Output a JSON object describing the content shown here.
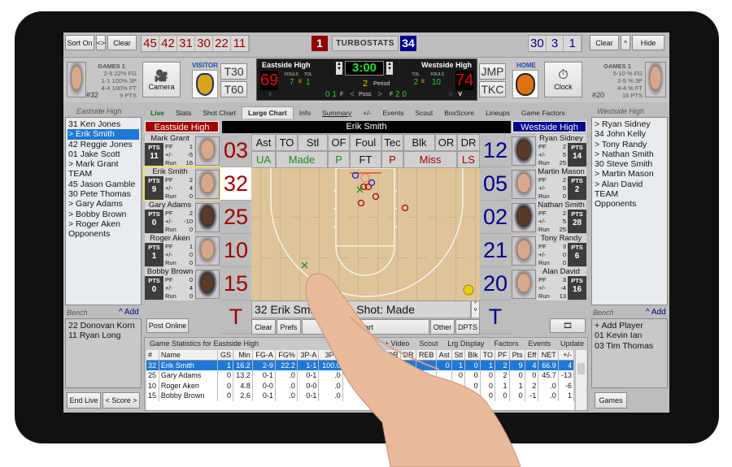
{
  "topbar": {
    "sort_label": "Sort On",
    "swap_label": "<>",
    "clear_left": "Clear",
    "left_numbers": [
      "45",
      "42",
      "31",
      "30",
      "22",
      "11"
    ],
    "left_team_count": "1",
    "logo": "TURBOSTATS",
    "right_team_count": "34",
    "right_numbers": [
      "30",
      "3",
      "1"
    ],
    "clear_right": "Clear",
    "up_label": "^",
    "hide_label": "Hide"
  },
  "visitor_player": {
    "games": "GAMES 1",
    "fg": "2-9 22% FG",
    "p3": "1-1 100% 3P",
    "ft": "4-4 100% FT",
    "number": "#32",
    "pts": "9 PTS"
  },
  "home_player": {
    "games": "GAMES 1",
    "fg": "5-10 % FG",
    "p3": "2-5 % 3P",
    "ft": "4-4 % FT",
    "number": "#20",
    "pts": "16 PTS"
  },
  "controls": {
    "camera": "Camera",
    "visitor": "VISITOR",
    "t30": "T30",
    "t60": "T60",
    "jmp": "JMP",
    "tkc": "TKC",
    "home": "HOME",
    "clock": "Clock"
  },
  "scoreboard": {
    "visitor_name": "Eastside High",
    "home_name": "Westside High",
    "visitor_score": "69",
    "home_score": "74",
    "clock": "3:00",
    "period": "2",
    "period_label": "Period",
    "fouls_label": "FOULS",
    "tol_label": "TOL",
    "visitor_fouls": "7",
    "visitor_tol": "1",
    "home_fouls": "10",
    "home_tol": "2",
    "bonus": "B",
    "visitor_sub": "9",
    "home_sub": "0",
    "home_sub2": "V",
    "poss_left": "0 1",
    "poss_right": "2 0",
    "f": "F",
    "poss": "Poss",
    "lt": "<",
    "gt": ">"
  },
  "tabs": [
    "Live",
    "Stats",
    "Shot Chart",
    "Large Chart",
    "Info",
    "Summary",
    "+/-",
    "Events",
    "Scout",
    "BoxScore",
    "Lineups",
    "Game Factors"
  ],
  "active_tab": "Large Chart",
  "left_list": {
    "title": "Eastside High",
    "items": [
      "31 Ken Jones",
      "> Erik Smith",
      "42 Reggie Jones",
      "01 Jake Scott",
      "> Mark Grant",
      "TEAM",
      "45 Jason Gamble",
      "30 Pete Thomas",
      "> Gary Adams",
      "> Bobby Brown",
      "> Roger Aken",
      "Opponents"
    ],
    "selected": "> Erik Smith",
    "bench_label": "Bench",
    "add_label": "^ Add",
    "bench": [
      "22 Donovan Korn",
      "11 Ryan Long"
    ],
    "end_live": "End Live",
    "score": "< Score >"
  },
  "right_list": {
    "title": "Westside High",
    "items": [
      "> Ryan Sidney",
      "34 John Kelly",
      "> Tony Randy",
      "> Nathan Smith",
      "30 Steve Smith",
      "> Martin Mason",
      "> Alan David",
      "TEAM",
      "Opponents"
    ],
    "bench_label": "Bench",
    "add_label": "^ Add",
    "bench": [
      "+ Add Player",
      "01 Kevin Ian",
      "03 Tim Thomas"
    ],
    "games": "Games"
  },
  "left_team": {
    "name": "Eastside High",
    "color": "#a00000",
    "players": [
      {
        "name": "Mark Grant",
        "pts": "11",
        "pf": "1",
        "pm": "-5",
        "run": "16"
      },
      {
        "name": "Erik Smith",
        "pts": "9",
        "pf": "2",
        "pm": "4",
        "run": "0"
      },
      {
        "name": "Gary Adams",
        "pts": "0",
        "pf": "2",
        "pm": "-10",
        "run": "0"
      },
      {
        "name": "Roger Aken",
        "pts": "1",
        "pf": "1",
        "pm": "0",
        "run": "0"
      },
      {
        "name": "Bobby Brown",
        "pts": "0",
        "pf": "0",
        "pm": "4",
        "run": "0"
      }
    ],
    "numbers": [
      "03",
      "32",
      "25",
      "10",
      "15",
      "T"
    ],
    "post_online": "Post Online"
  },
  "right_team": {
    "name": "Westside High",
    "color": "#00008b",
    "players": [
      {
        "name": "Ryan Sidney",
        "pts": "14",
        "pf": "2",
        "pm": "5",
        "run": "25"
      },
      {
        "name": "Martin Mason",
        "pts": "2",
        "pf": "2",
        "pm": "5",
        "run": "0"
      },
      {
        "name": "Nathan Smith",
        "pts": "28",
        "pf": "2",
        "pm": "5",
        "run": "25"
      },
      {
        "name": "Tony Randy",
        "pts": "6",
        "pf": "3",
        "pm": "0",
        "run": "0"
      },
      {
        "name": "Alan David",
        "pts": "16",
        "pf": "3",
        "pm": "-4",
        "run": "13"
      }
    ],
    "numbers": [
      "12",
      "05",
      "02",
      "21",
      "20",
      "T"
    ]
  },
  "stat_labels": {
    "pts": "PTS",
    "pf": "PF",
    "pm": "+/-",
    "run": "Run"
  },
  "center": {
    "player": "Erik Smith",
    "actions_top": [
      "Ast",
      "TO",
      "Stl",
      "OF",
      "Foul",
      "Tec",
      "Blk",
      "OR",
      "DR"
    ],
    "actions_bottom": [
      "UA",
      "Made",
      "P",
      "FT",
      "P",
      "Miss",
      "LS"
    ],
    "event_text": "32 Erik Smith Jump Shot: Made",
    "clear": "Clear",
    "prefs": "Prefs",
    "start": "Start",
    "other": "Other",
    "dpts": "DPTS"
  },
  "stats": {
    "title": "Game Statistics for Eastside High",
    "links": [
      "+ Video",
      "Scout",
      "Lrg Display",
      "Factors",
      "Events",
      "Update"
    ],
    "columns": [
      "#",
      "Name",
      "GS",
      "Min",
      "FG-A",
      "FG%",
      "3P-A",
      "3P%",
      "FT-A",
      "FT%",
      "OR",
      "DR",
      "REB",
      "Ast",
      "Stl",
      "Blk",
      "TO",
      "PF",
      "Pts",
      "Eff",
      "NET",
      "+/-"
    ],
    "rows": [
      [
        "32",
        "Erik Smith",
        "1",
        "16.2",
        "2-9",
        "22.2",
        "1-1",
        "100.0",
        "",
        "",
        "",
        "",
        "",
        "0",
        "1",
        "0",
        "1",
        "2",
        "9",
        "4",
        "66.9",
        "4"
      ],
      [
        "25",
        "Gary Adams",
        "0",
        "13.2",
        "0-1",
        ".0",
        "0-1",
        ".0",
        "",
        "",
        "",
        "",
        "",
        "",
        "0",
        "0",
        "0",
        "2",
        "0",
        "0",
        "45.7",
        "-13"
      ],
      [
        "10",
        "Roger Aken",
        "0",
        "4.8",
        "0-0",
        ".0",
        "0-0",
        ".0",
        "",
        "",
        "",
        "",
        "",
        "",
        "",
        "0",
        "0",
        "1",
        "1",
        "2",
        ".0",
        "-6"
      ],
      [
        "15",
        "Bobby Brown",
        "0",
        "2.6",
        "0-1",
        ".0",
        "0-1",
        ".0",
        "",
        "",
        "",
        "",
        "",
        "",
        "",
        "",
        "0",
        "0",
        "0",
        "-1",
        ".0",
        "1"
      ]
    ]
  }
}
